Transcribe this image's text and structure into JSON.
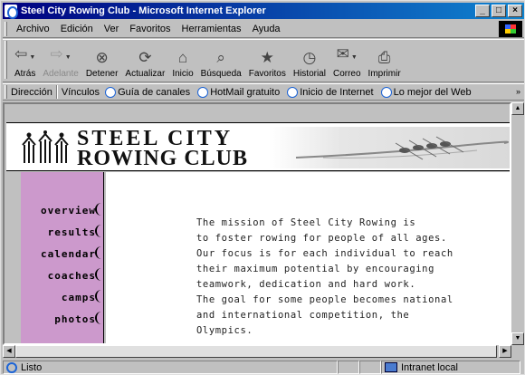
{
  "window": {
    "title": "Steel City Rowing Club - Microsoft Internet Explorer",
    "buttons": [
      "_",
      "□",
      "×"
    ]
  },
  "menu": [
    "Archivo",
    "Edición",
    "Ver",
    "Favoritos",
    "Herramientas",
    "Ayuda"
  ],
  "toolbar": [
    {
      "label": "Atrás",
      "icon": "back-arrow-icon",
      "glyph": "⇦",
      "disabled": false,
      "dropdown": true
    },
    {
      "label": "Adelante",
      "icon": "forward-arrow-icon",
      "glyph": "⇨",
      "disabled": true,
      "dropdown": true
    },
    {
      "label": "Detener",
      "icon": "stop-icon",
      "glyph": "⊗",
      "disabled": false,
      "dropdown": false
    },
    {
      "label": "Actualizar",
      "icon": "refresh-icon",
      "glyph": "⟳",
      "disabled": false,
      "dropdown": false
    },
    {
      "label": "Inicio",
      "icon": "home-icon",
      "glyph": "⌂",
      "disabled": false,
      "dropdown": false
    },
    {
      "label": "Búsqueda",
      "icon": "search-icon",
      "glyph": "⌕",
      "disabled": false,
      "dropdown": false
    },
    {
      "label": "Favoritos",
      "icon": "favorites-icon",
      "glyph": "★",
      "disabled": false,
      "dropdown": false
    },
    {
      "label": "Historial",
      "icon": "history-icon",
      "glyph": "◷",
      "disabled": false,
      "dropdown": false
    },
    {
      "label": "Correo",
      "icon": "mail-icon",
      "glyph": "✉",
      "disabled": false,
      "dropdown": true
    },
    {
      "label": "Imprimir",
      "icon": "print-icon",
      "glyph": "⎙",
      "disabled": false,
      "dropdown": false
    }
  ],
  "address": {
    "label": "Dirección",
    "links_label": "Vínculos",
    "links": [
      "Guía de canales",
      "HotMail gratuito",
      "Inicio de Internet",
      "Lo mejor del Web"
    ],
    "more": "»"
  },
  "page": {
    "logo_line1": "STEEL CITY",
    "logo_line2": "ROWING CLUB",
    "nav": [
      "overview",
      "results",
      "calendar",
      "coaches",
      "camps",
      "photos"
    ],
    "mission": [
      "The mission of Steel City Rowing is",
      "to foster rowing for people of all ages.",
      "Our focus is for each individual to reach",
      "their maximum potential by encouraging",
      "teamwork, dedication and hard work.",
      "The goal for some people becomes national",
      "and international competition, the",
      "Olympics."
    ]
  },
  "status": {
    "text": "Listo",
    "zone": "Intranet local"
  },
  "colors": {
    "title_bar": "#000080",
    "sidebar": "#cc99cc",
    "page_bg": "#ffffff",
    "chrome": "#c0c0c0"
  }
}
